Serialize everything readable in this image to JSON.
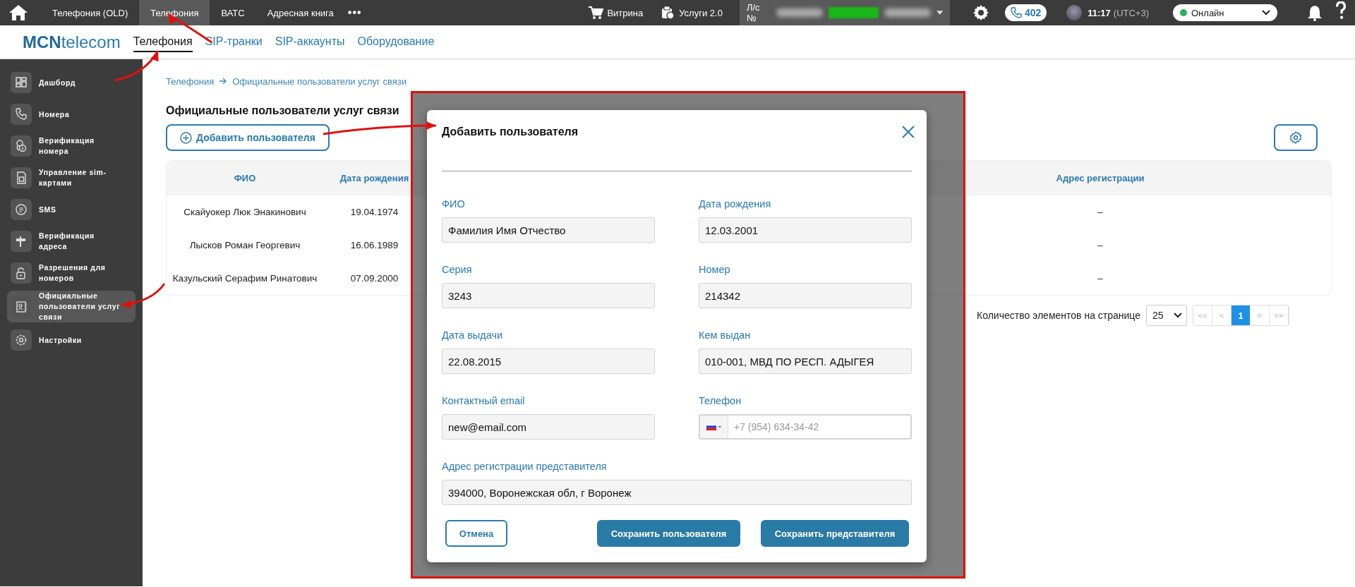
{
  "top_bar": {
    "nav": [
      {
        "label": "Телефония (OLD)",
        "selected": false
      },
      {
        "label": "Телефония",
        "selected": true
      },
      {
        "label": "ВАТС",
        "selected": false
      },
      {
        "label": "Адресная книга",
        "selected": false
      }
    ],
    "more": "•••",
    "shop": "Витрина",
    "services": "Услуги 2.0",
    "account_label": "Л/с №",
    "calls": "402",
    "time": "11:17",
    "timezone": "(UTC+3)",
    "status": "Онлайн"
  },
  "header": {
    "logo_bold": "MCN",
    "logo_rest": "telecom",
    "tabs": [
      {
        "label": "Телефония",
        "selected": true
      },
      {
        "label": "SIP-транки",
        "selected": false
      },
      {
        "label": "SIP-аккаунты",
        "selected": false
      },
      {
        "label": "Оборудование",
        "selected": false
      }
    ]
  },
  "sidebar": {
    "items": [
      {
        "label": "Дашборд",
        "selected": false
      },
      {
        "label": "Номера",
        "selected": false
      },
      {
        "label": "Верификация номера",
        "selected": false
      },
      {
        "label": "Управление sim-картами",
        "selected": false
      },
      {
        "label": "SMS",
        "selected": false
      },
      {
        "label": "Верификация адреса",
        "selected": false
      },
      {
        "label": "Разрешения для номеров",
        "selected": false
      },
      {
        "label": "Официальные пользователи услуг связи",
        "selected": true
      },
      {
        "label": "Настройки",
        "selected": false
      }
    ]
  },
  "breadcrumb": [
    "Телефония",
    "Официальные пользователи услуг связи"
  ],
  "page_title": "Официальные пользователи услуг связи",
  "add_button": "Добавить пользователя",
  "table": {
    "columns": [
      "ФИО",
      "Дата рождения",
      "Адрес регистрации"
    ],
    "rows": [
      {
        "name": "Скайуокер Люк Энакинович",
        "birth_date": "19.04.1974",
        "address": "–"
      },
      {
        "name": "Лысков Роман Георгевич",
        "birth_date": "16.06.1989",
        "address": "–"
      },
      {
        "name": "Казульский Серафим Ринатович",
        "birth_date": "07.09.2000",
        "address": "–"
      }
    ]
  },
  "pagination": {
    "label": "Количество элементов на странице",
    "page_size": "25",
    "pages": [
      {
        "label": "<<",
        "selected": false,
        "disabled": true
      },
      {
        "label": "<",
        "selected": false,
        "disabled": true
      },
      {
        "label": "1",
        "selected": true,
        "disabled": false
      },
      {
        "label": ">",
        "selected": false,
        "disabled": true
      },
      {
        "label": ">>",
        "selected": false,
        "disabled": true
      }
    ]
  },
  "dialog": {
    "title": "Добавить пользователя",
    "fields": [
      {
        "kind": "text",
        "label": "ФИО",
        "value": "Фамилия Имя Отчество"
      },
      {
        "kind": "text",
        "label": "Дата рождения",
        "value": "12.03.2001"
      },
      {
        "kind": "text",
        "label": "Серия",
        "value": "3243"
      },
      {
        "kind": "text",
        "label": "Номер",
        "value": "214342"
      },
      {
        "kind": "text",
        "label": "Дата выдачи",
        "value": "22.08.2015"
      },
      {
        "kind": "text",
        "label": "Кем выдан",
        "value": "010-001, МВД ПО РЕСП. АДЫГЕЯ"
      },
      {
        "kind": "text",
        "label": "Контактный email",
        "value": "new@email.com"
      },
      {
        "kind": "phone",
        "label": "Телефон",
        "placeholder": "+7 (954) 634-34-42"
      },
      {
        "kind": "wide",
        "label": "Адрес регистрации представителя",
        "value": "394000, Воронежская обл, г Воронеж"
      }
    ],
    "buttons": [
      {
        "kind": "secondary",
        "label": "Отмена"
      },
      {
        "kind": "primary",
        "label": "Сохранить пользователя"
      },
      {
        "kind": "primary",
        "label": "Сохранить представителя"
      }
    ]
  }
}
